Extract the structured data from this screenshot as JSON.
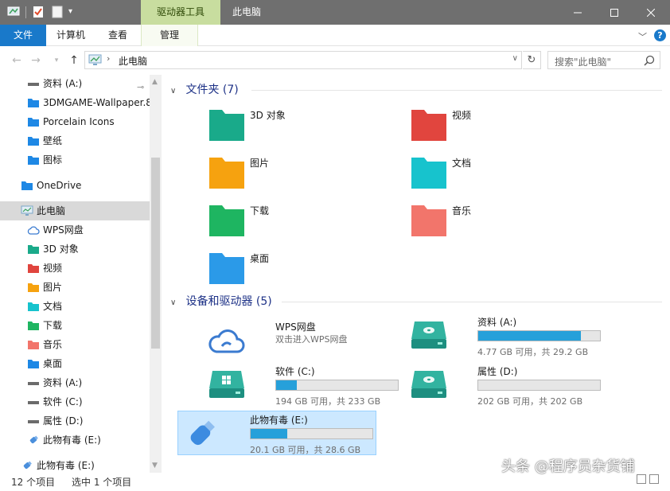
{
  "titlebar": {
    "context_tab": "驱动器工具",
    "title": "此电脑"
  },
  "ribbon": {
    "tabs": [
      "文件",
      "计算机",
      "查看",
      "管理"
    ],
    "help": "?"
  },
  "address": {
    "path": "此电脑",
    "search_placeholder": "搜索\"此电脑\""
  },
  "sidebar": {
    "items": [
      {
        "label": "资料 (A:)",
        "icon": "drive-icon",
        "pinned": true
      },
      {
        "label": "3DMGAME-Wallpaper.8",
        "icon": "folder-blue-icon"
      },
      {
        "label": "Porcelain Icons",
        "icon": "folder-blue-icon"
      },
      {
        "label": "壁纸",
        "icon": "folder-blue-icon"
      },
      {
        "label": "图标",
        "icon": "folder-blue-icon"
      },
      {
        "label": "OneDrive",
        "icon": "folder-blue-icon"
      },
      {
        "label": "此电脑",
        "icon": "computer-icon",
        "selected": true
      },
      {
        "label": "WPS网盘",
        "icon": "cloud-icon"
      },
      {
        "label": "3D 对象",
        "icon": "folder-teal-icon"
      },
      {
        "label": "视频",
        "icon": "folder-red-icon"
      },
      {
        "label": "图片",
        "icon": "folder-orange-icon"
      },
      {
        "label": "文档",
        "icon": "folder-cyan-icon"
      },
      {
        "label": "下载",
        "icon": "folder-green-icon"
      },
      {
        "label": "音乐",
        "icon": "folder-salmon-icon"
      },
      {
        "label": "桌面",
        "icon": "folder-blue-icon"
      },
      {
        "label": "资料 (A:)",
        "icon": "drive-icon"
      },
      {
        "label": "软件 (C:)",
        "icon": "drive-icon"
      },
      {
        "label": "属性 (D:)",
        "icon": "drive-icon"
      },
      {
        "label": "此物有毒 (E:)",
        "icon": "usb-icon"
      },
      {
        "label": "此物有毒 (E:)",
        "icon": "usb-icon"
      }
    ]
  },
  "folders_group": {
    "title": "文件夹",
    "count": "(7)",
    "items": [
      {
        "label": "3D 对象",
        "color": "#1aaa8a"
      },
      {
        "label": "视频",
        "color": "#e0453e"
      },
      {
        "label": "图片",
        "color": "#f6a20f"
      },
      {
        "label": "文档",
        "color": "#17c3cd"
      },
      {
        "label": "下载",
        "color": "#1fb561"
      },
      {
        "label": "音乐",
        "color": "#f2756b"
      },
      {
        "label": "桌面",
        "color": "#2b9ae8"
      }
    ]
  },
  "drives_group": {
    "title": "设备和驱动器",
    "count": "(5)",
    "items": [
      {
        "name": "WPS网盘",
        "sub": "双击进入WPS网盘",
        "type": "cloud"
      },
      {
        "name": "资料 (A:)",
        "sub": "4.77 GB 可用，共 29.2 GB",
        "type": "drive",
        "fill": 0.84
      },
      {
        "name": "软件 (C:)",
        "sub": "194 GB 可用，共 233 GB",
        "type": "windows-drive",
        "fill": 0.17
      },
      {
        "name": "属性 (D:)",
        "sub": "202 GB 可用，共 202 GB",
        "type": "drive",
        "fill": 0.0
      },
      {
        "name": "此物有毒 (E:)",
        "sub": "20.1 GB 可用，共 28.6 GB",
        "type": "usb",
        "fill": 0.3,
        "selected": true
      }
    ]
  },
  "statusbar": {
    "items": "12 个项目",
    "selected": "选中 1 个项目"
  },
  "watermark": "头条 @程序员杂货铺",
  "colors": {
    "accent": "#1979ca",
    "titlebar": "#6f6f6f",
    "context_tab": "#c8dd9f",
    "drive_fill": "#26a0da",
    "selection": "#cce8ff"
  }
}
